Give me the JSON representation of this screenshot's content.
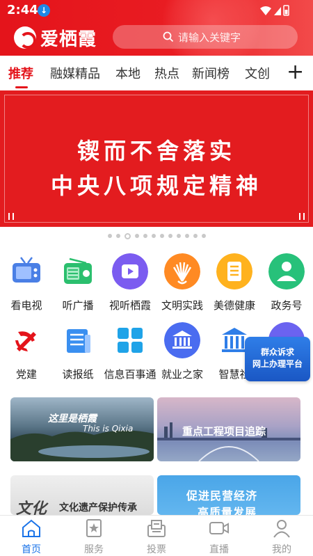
{
  "status_bar": {
    "time": "2:44"
  },
  "header": {
    "app_name": "爱栖霞",
    "search_placeholder": "请输入关键字"
  },
  "tabs": [
    {
      "label": "推荐",
      "active": true
    },
    {
      "label": "融媒精品"
    },
    {
      "label": "本地"
    },
    {
      "label": "热点"
    },
    {
      "label": "新闻榜"
    },
    {
      "label": "文创"
    }
  ],
  "banner": {
    "line1": "锲而不舍落实",
    "line2": "中央八项规定精神",
    "page_count": 12,
    "active_page": 3
  },
  "grid": [
    {
      "label": "看电视",
      "icon": "tv-icon",
      "color": "#4a7fe5"
    },
    {
      "label": "听广播",
      "icon": "radio-icon",
      "color": "#2bbf6e"
    },
    {
      "label": "视听栖霞",
      "icon": "video-icon",
      "color": "#7b5cf0"
    },
    {
      "label": "文明实践",
      "icon": "hand-icon",
      "color": "#ff8a23"
    },
    {
      "label": "美德健康",
      "icon": "document-icon",
      "color": "#ffb21e"
    },
    {
      "label": "政务号",
      "icon": "user-icon",
      "color": "#27c17a"
    },
    {
      "label": "党建",
      "icon": "party-icon",
      "color": "#e4141b"
    },
    {
      "label": "读报纸",
      "icon": "newspaper-icon",
      "color": "#3a8ff0"
    },
    {
      "label": "信息百事通",
      "icon": "grid-icon",
      "color": "#1fa3e8"
    },
    {
      "label": "就业之家",
      "icon": "building-icon",
      "color": "#4a6cf0"
    },
    {
      "label": "智慧社",
      "icon": "pillar-icon",
      "color": "#2f7ee8"
    }
  ],
  "float_badge": {
    "line1": "群众诉求",
    "line2": "网上办理平台"
  },
  "cards": [
    {
      "text": "这里是栖霞",
      "subtext": "This is Qixia"
    },
    {
      "text": "重点工程项目追踪"
    },
    {
      "text": "文化遗产保护传承"
    },
    {
      "text": "促进民营经济",
      "subtext": "高质量发展"
    }
  ],
  "bottom_nav": [
    {
      "label": "首页",
      "icon": "home-icon",
      "active": true
    },
    {
      "label": "服务",
      "icon": "service-icon"
    },
    {
      "label": "投票",
      "icon": "vote-icon"
    },
    {
      "label": "直播",
      "icon": "live-icon"
    },
    {
      "label": "我的",
      "icon": "profile-icon"
    }
  ],
  "colors": {
    "brand_red": "#e4141b",
    "active_blue": "#1a73e8",
    "badge_blue": "#1a57c4"
  }
}
